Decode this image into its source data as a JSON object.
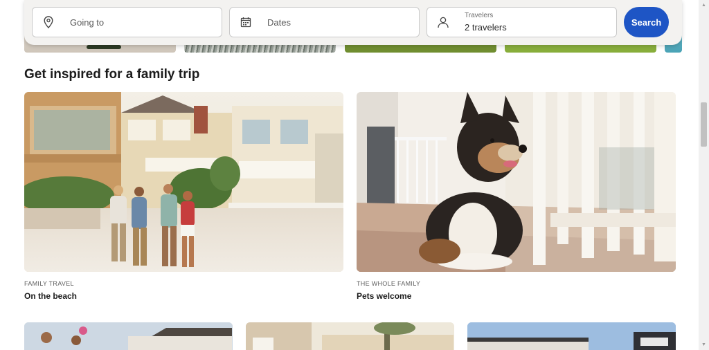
{
  "search": {
    "going_placeholder": "Going to",
    "dates_placeholder": "Dates",
    "travelers_label": "Travelers",
    "travelers_value": "2 travelers",
    "search_label": "Search",
    "icons": [
      "location-pin-icon",
      "calendar-icon",
      "person-icon"
    ]
  },
  "section": {
    "title": "Get inspired for a family trip"
  },
  "cards": [
    {
      "kicker": "FAMILY TRAVEL",
      "title": "On the beach"
    },
    {
      "kicker": "THE WHOLE FAMILY",
      "title": "Pets welcome"
    }
  ],
  "colors": {
    "accent": "#1e55c5",
    "background": "#ffffff",
    "search_bar": "#f3f2f0"
  }
}
